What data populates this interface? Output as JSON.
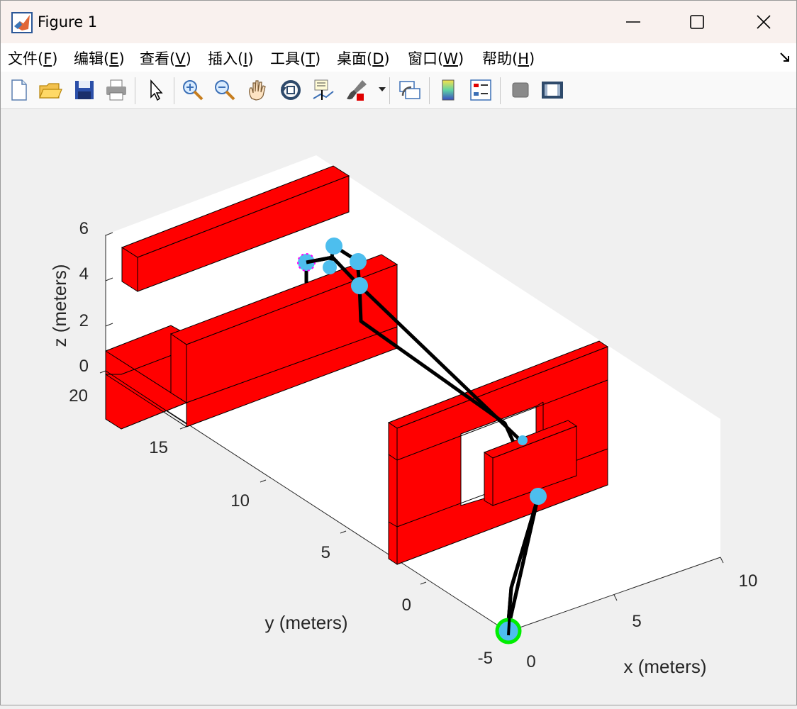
{
  "window": {
    "title": "Figure 1"
  },
  "menu": [
    {
      "pre": "文件(",
      "key": "F",
      "post": ")"
    },
    {
      "pre": "编辑(",
      "key": "E",
      "post": ")"
    },
    {
      "pre": "查看(",
      "key": "V",
      "post": ")"
    },
    {
      "pre": "插入(",
      "key": "I",
      "post": ")"
    },
    {
      "pre": "工具(",
      "key": "T",
      "post": ")"
    },
    {
      "pre": "桌面(",
      "key": "D",
      "post": ")"
    },
    {
      "pre": "窗口(",
      "key": "W",
      "post": ")"
    },
    {
      "pre": "帮助(",
      "key": "H",
      "post": ")"
    }
  ],
  "toolbar_icons": [
    "new-figure-icon",
    "open-file-icon",
    "save-icon",
    "print-icon",
    "pointer-icon",
    "zoom-in-icon",
    "zoom-out-icon",
    "pan-icon",
    "rotate-3d-icon",
    "data-cursor-icon",
    "brush-icon",
    "brush-dropdown-icon",
    "link-plot-icon",
    "colorbar-icon",
    "legend-icon",
    "hide-plot-tools-icon",
    "show-plot-tools-icon"
  ],
  "colors": {
    "obstacle": "#ff0000",
    "path": "#000000",
    "waypoint": "#4dbeee",
    "start": "#00ff00",
    "axes_bg": "#ffffff"
  },
  "chart_data": {
    "type": "3d-scene",
    "xlabel": "x (meters)",
    "ylabel": "y (meters)",
    "zlabel": "z (meters)",
    "xticks": [
      "0",
      "5",
      "10"
    ],
    "yticks": [
      "-5",
      "0",
      "5",
      "10",
      "15",
      "20"
    ],
    "zticks": [
      "0",
      "2",
      "4",
      "6"
    ],
    "xlim": [
      0,
      10
    ],
    "ylim": [
      -5,
      20
    ],
    "zlim": [
      0,
      6
    ],
    "grid": false,
    "obstacles": "red rectangular boxes",
    "start_marker": "green circle",
    "waypoints": "light blue circles connected by black path lines"
  }
}
